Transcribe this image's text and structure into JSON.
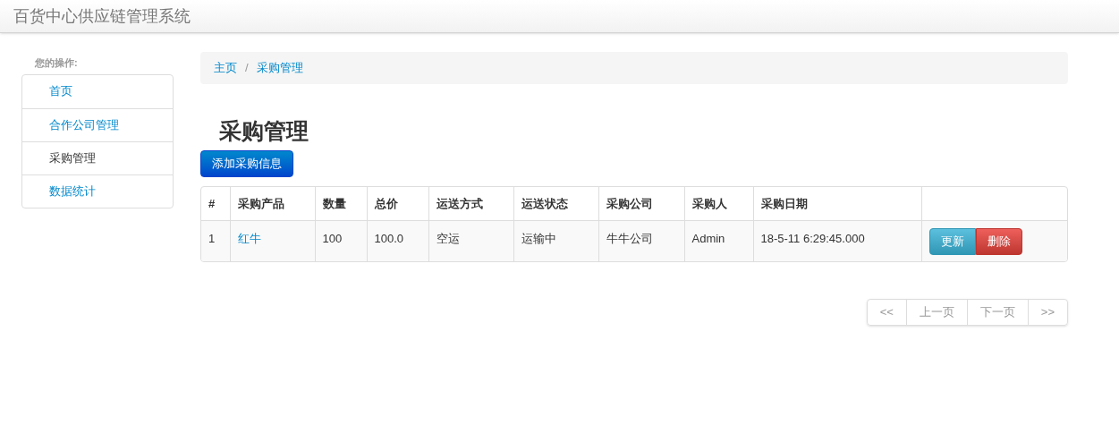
{
  "navbar": {
    "brand": "百货中心供应链管理系统"
  },
  "sidebar": {
    "heading": "您的操作:",
    "items": [
      {
        "label": "首页",
        "selected": false
      },
      {
        "label": "合作公司管理",
        "selected": false
      },
      {
        "label": "采购管理",
        "selected": true
      },
      {
        "label": "数据统计",
        "selected": false
      }
    ]
  },
  "breadcrumb": [
    "主页",
    "采购管理"
  ],
  "breadcrumb_separator": "/",
  "page_title": "采购管理",
  "add_button": "添加采购信息",
  "table": {
    "columns": [
      "#",
      "采购产品",
      "数量",
      "总价",
      "运送方式",
      "运送状态",
      "采购公司",
      "采购人",
      "采购日期"
    ],
    "rows": [
      {
        "cells": [
          "1",
          "红牛",
          "100",
          "100.0",
          "空运",
          "运输中",
          "牛牛公司",
          "Admin",
          "18-5-11 6:29:45.000"
        ],
        "actions": [
          "更新",
          "删除"
        ]
      }
    ]
  },
  "pagination": [
    {
      "label": "<<",
      "disabled": true
    },
    {
      "label": "上一页",
      "disabled": true
    },
    {
      "label": "下一页",
      "disabled": true
    },
    {
      "label": ">>",
      "disabled": true
    }
  ]
}
